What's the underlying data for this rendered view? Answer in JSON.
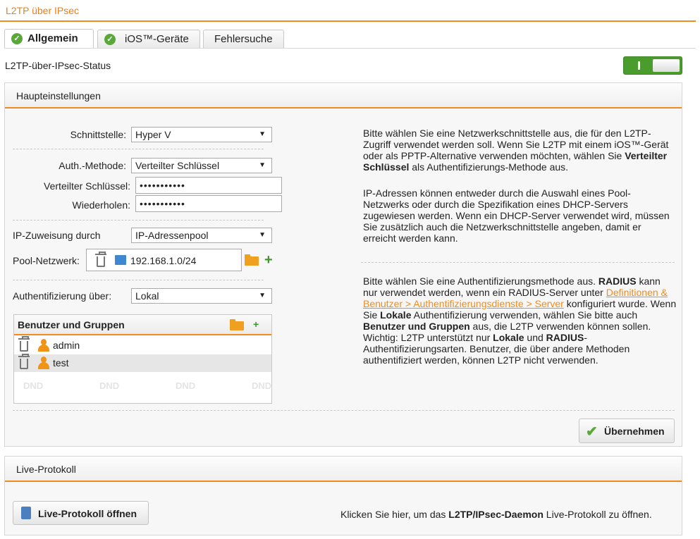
{
  "page": {
    "title": "L2TP über IPsec"
  },
  "tabs": [
    {
      "label": "Allgemein"
    },
    {
      "label": "iOS™-Geräte"
    },
    {
      "label": "Fehlersuche"
    }
  ],
  "status": {
    "label": "L2TP-über-IPsec-Status",
    "enabled": true
  },
  "main": {
    "heading": "Haupteinstellungen",
    "interface_label": "Schnittstelle:",
    "interface_value": "Hyper V",
    "auth_method_label": "Auth.-Methode:",
    "auth_method_value": "Verteilter Schlüssel",
    "psk_label": "Verteilter Schlüssel:",
    "psk_value": "•••••••••••",
    "repeat_label": "Wiederholen:",
    "repeat_value": "•••••••••••",
    "ip_assign_label": "IP-Zuweisung durch",
    "ip_assign_value": "IP-Adressenpool",
    "pool_label": "Pool-Netzwerk:",
    "pool_value": "192.168.1.0/24",
    "auth_via_label": "Authentifizierung über:",
    "auth_via_value": "Lokal",
    "users_groups": {
      "heading": "Benutzer und Gruppen",
      "items": [
        "admin",
        "test"
      ],
      "placeholder": "DND"
    },
    "help1": {
      "text": "Bitte wählen Sie eine Netzwerkschnittstelle aus, die für den L2TP-Zugriff verwendet werden soll. Wenn Sie L2TP mit einem iOS™-Gerät oder als PPTP-Alternative verwenden möchten, wählen Sie ",
      "bold": "Verteilter Schlüssel",
      "text_end": " als Authentifizierungs-Methode aus."
    },
    "help2": "IP-Adressen können entweder durch die Auswahl eines Pool-Netzwerks oder durch die Spezifikation eines DHCP-Servers zugewiesen werden. Wenn ein DHCP-Server verwendet wird, müssen Sie zusätzlich auch die Netzwerkschnittstelle angeben, damit er erreicht werden kann.",
    "help3": {
      "t1": "Bitte wählen Sie eine Authentifizierungsmethode aus. ",
      "b1": "RADIUS",
      "t2": " kann nur verwendet werden, wenn ein RADIUS-Server unter ",
      "link": "Definitionen & Benutzer > Authentifizierungsdienste > Server",
      "t3": " konfiguriert wurde. Wenn Sie ",
      "b2": "Lokale",
      "t4": " Authentifizierung verwenden, wählen Sie bitte auch ",
      "b3": "Benutzer und Gruppen",
      "t5": " aus, die L2TP verwenden können sollen. Wichtig: L2TP unterstützt nur ",
      "b4": "Lokale",
      "t6": " und ",
      "b5": "RADIUS",
      "t7": "-Authentifizierungsarten. Benutzer, die über andere Methoden authentifiziert werden, können L2TP nicht verwenden."
    },
    "apply_label": "Übernehmen"
  },
  "live": {
    "heading": "Live-Protokoll",
    "button_label": "Live-Protokoll öffnen",
    "text1": "Klicken Sie hier, um das ",
    "bold": "L2TP/IPsec-Daemon",
    "text2": " Live-Protokoll zu öffnen."
  },
  "colors": {
    "accent": "#f08c1f",
    "toggle_on": "#4a9c2c",
    "check": "#5aa83a"
  },
  "icons": [
    "check-icon",
    "trash-icon",
    "network-icon",
    "folder-icon",
    "plus-icon",
    "user-icon",
    "clipboard-icon",
    "dropdown-arrow-icon"
  ]
}
